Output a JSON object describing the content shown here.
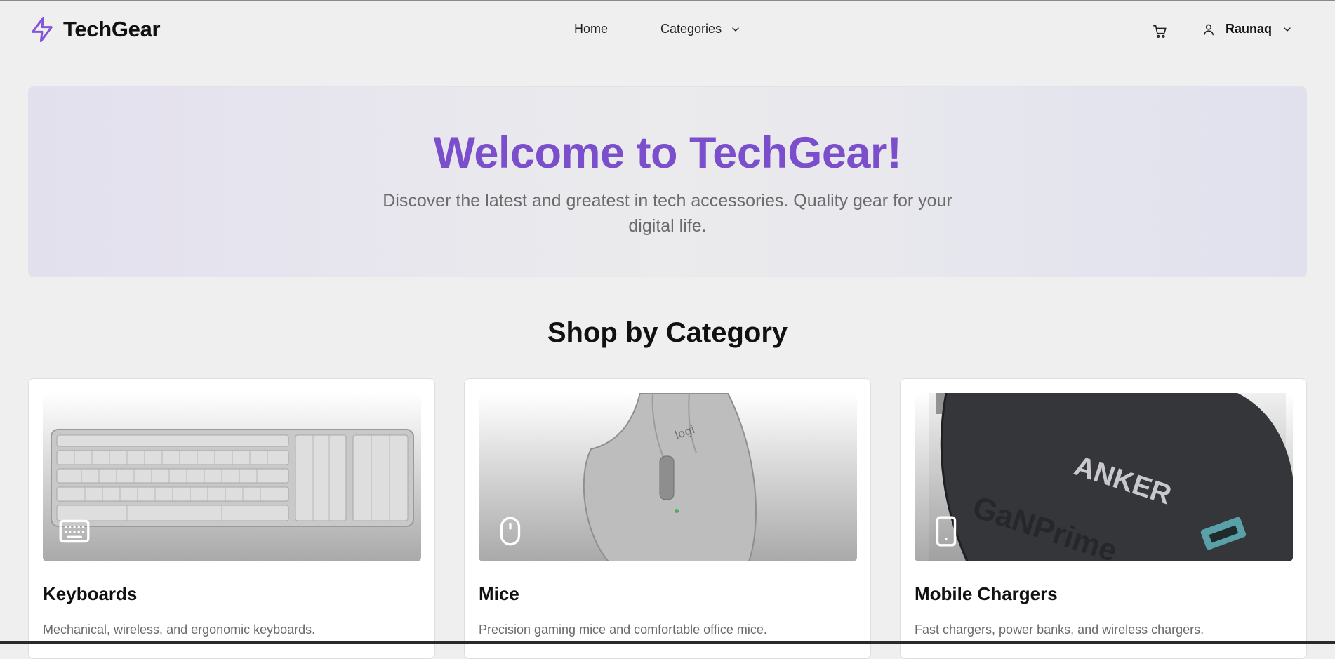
{
  "header": {
    "brand": "TechGear",
    "nav": {
      "home": "Home",
      "categories": "Categories"
    },
    "user": {
      "name": "Raunaq"
    }
  },
  "hero": {
    "title": "Welcome to TechGear!",
    "subtitle": "Discover the latest and greatest in tech accessories. Quality gear for your digital life."
  },
  "section": {
    "title": "Shop by Category"
  },
  "categories": [
    {
      "title": "Keyboards",
      "description": "Mechanical, wireless, and ergonomic keyboards.",
      "icon": "keyboard-icon"
    },
    {
      "title": "Mice",
      "description": "Precision gaming mice and comfortable office mice.",
      "icon": "mouse-icon"
    },
    {
      "title": "Mobile Chargers",
      "description": "Fast chargers, power banks, and wireless chargers.",
      "icon": "phone-icon"
    }
  ],
  "product_image_text": {
    "mouse_brand": "logi",
    "charger_brand": "ANKER",
    "charger_model": "GaNPrime"
  },
  "colors": {
    "accent": "#7b4fcc",
    "background": "#efefef",
    "card": "#ffffff"
  }
}
